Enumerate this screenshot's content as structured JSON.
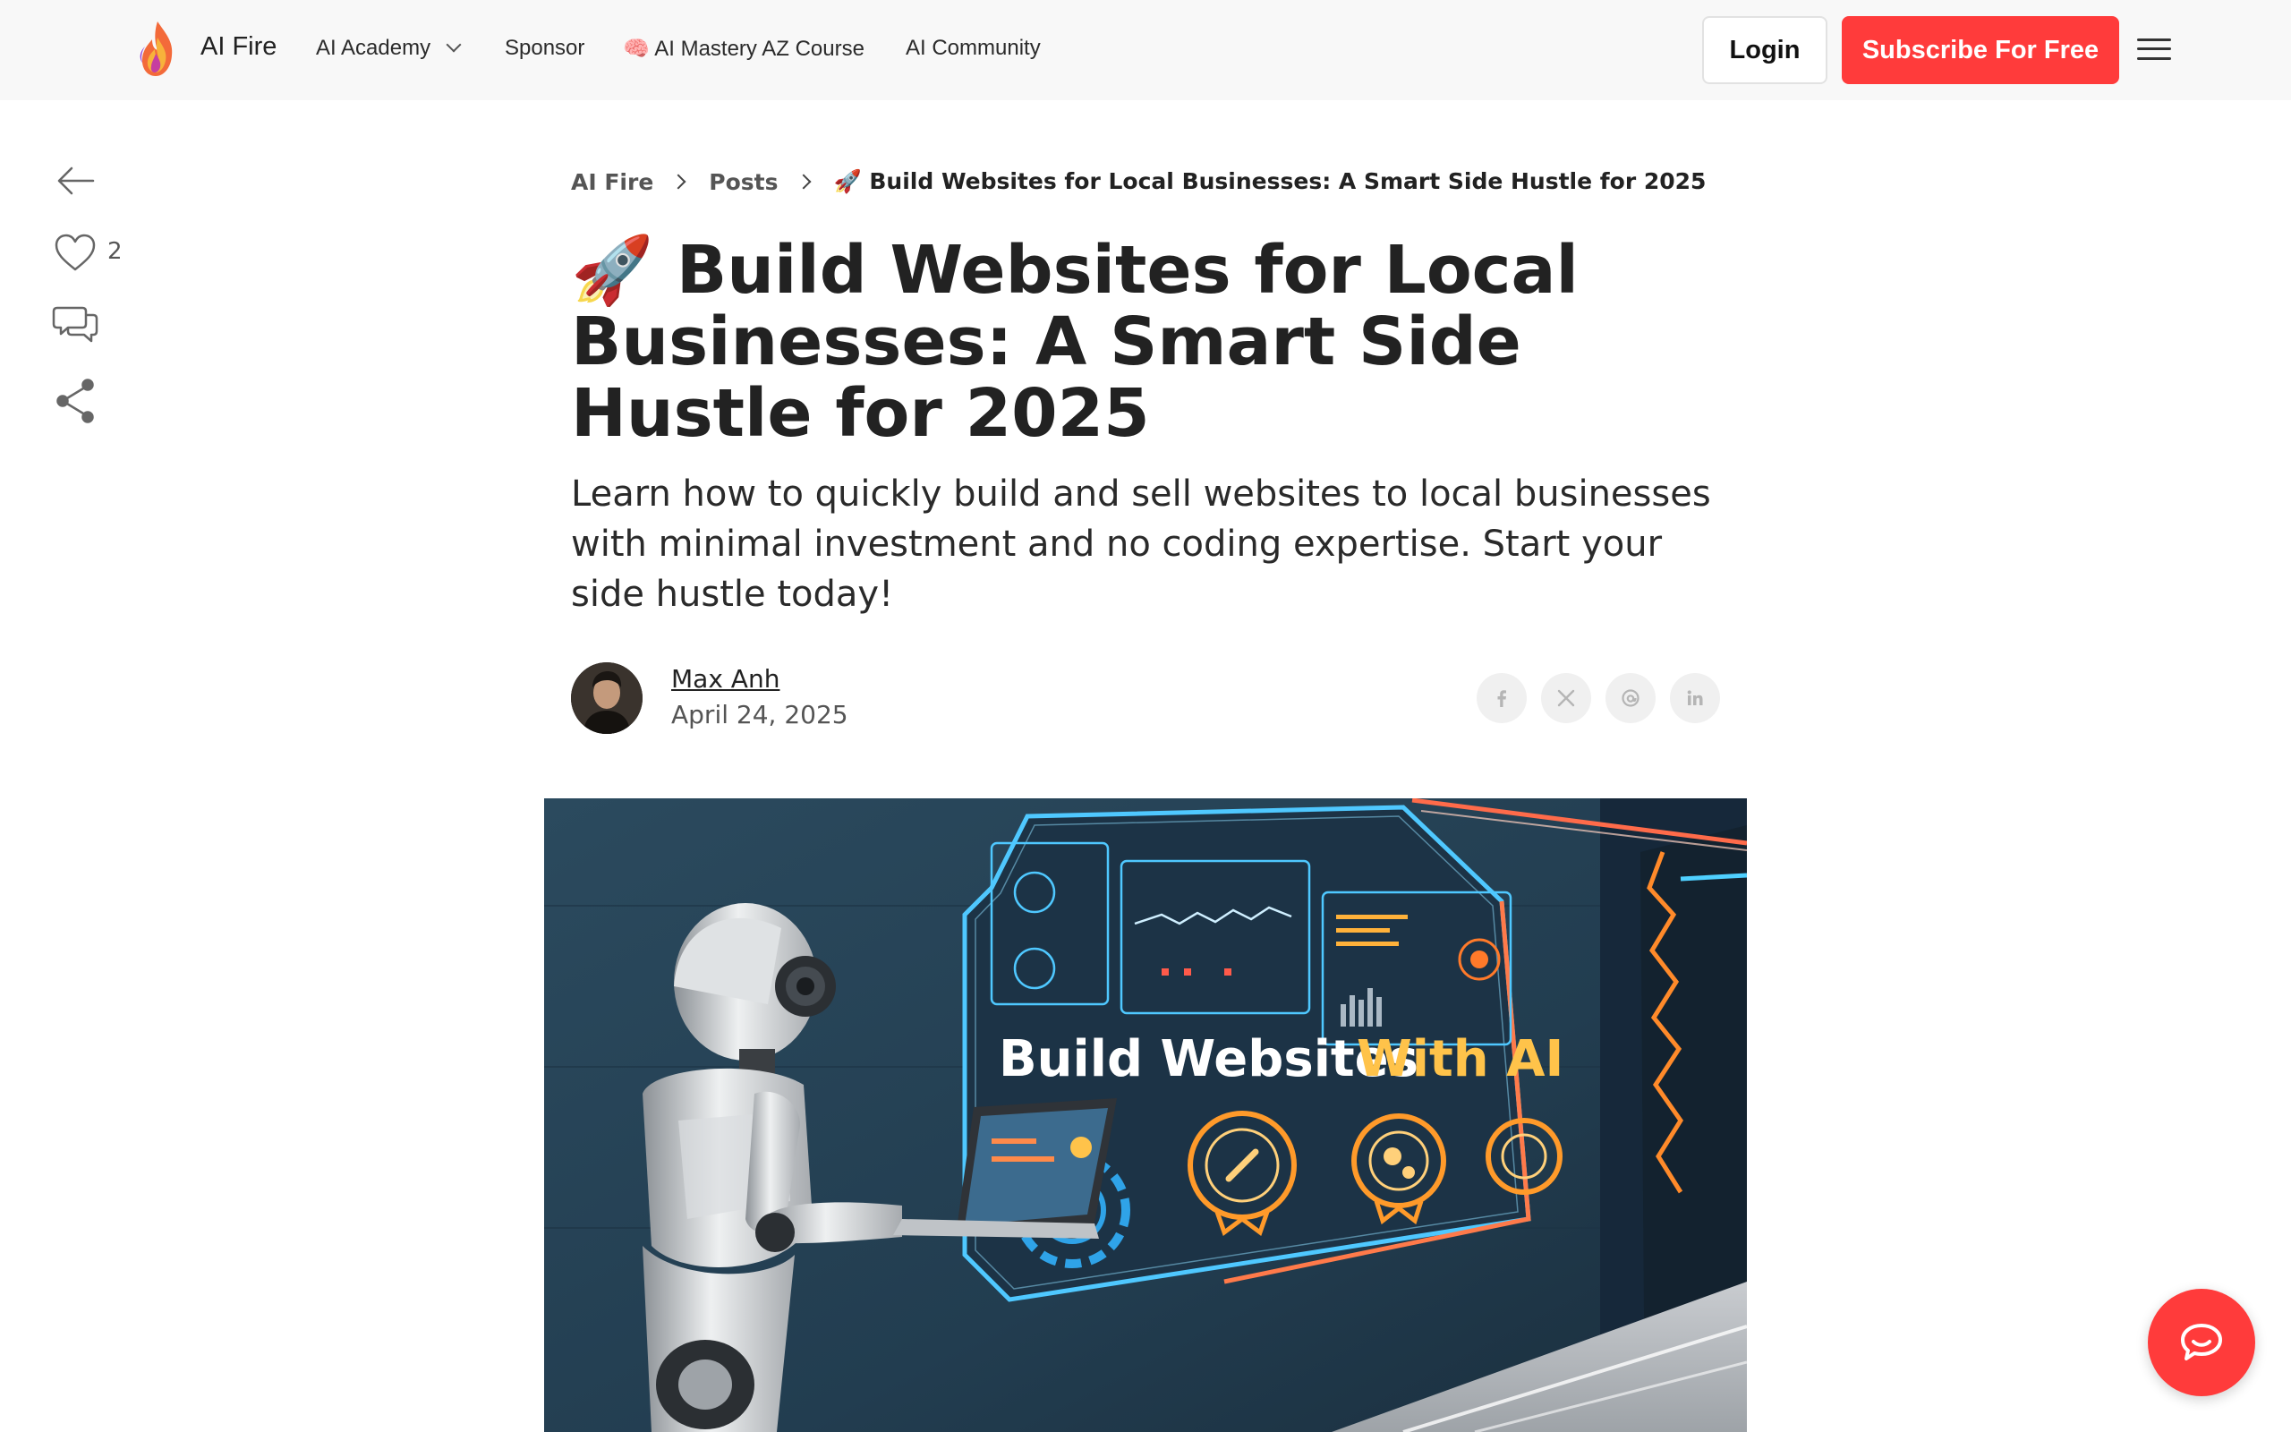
{
  "header": {
    "brand": "AI Fire",
    "nav": [
      {
        "label": "AI Academy",
        "has_dropdown": true
      },
      {
        "label": "Sponsor"
      },
      {
        "label": "🧠 AI Mastery AZ Course"
      },
      {
        "label": "AI Community"
      }
    ],
    "login_label": "Login",
    "subscribe_label": "Subscribe For Free",
    "accent_color": "#ff3b3b"
  },
  "rail": {
    "icons": [
      "back-arrow-icon",
      "heart-icon",
      "comment-icon",
      "share-icon"
    ],
    "like_count": "2"
  },
  "breadcrumb": {
    "items": [
      "AI Fire",
      "Posts"
    ],
    "current": "🚀 Build Websites for Local Businesses: A Smart Side Hustle for 2025"
  },
  "article": {
    "title": "🚀 Build Websites for Local Businesses: A Smart Side Hustle for 2025",
    "subtitle": "Learn how to quickly build and sell websites to local businesses with minimal investment and no coding expertise. Start your side hustle today!",
    "author": "Max Anh",
    "date": "April 24, 2025",
    "share_icons": [
      "facebook-icon",
      "x-icon",
      "threads-icon",
      "linkedin-icon"
    ]
  },
  "hero": {
    "text_part1": "Build Websites",
    "text_part2": "With AI"
  },
  "chat": {
    "icon": "chat-icon"
  }
}
